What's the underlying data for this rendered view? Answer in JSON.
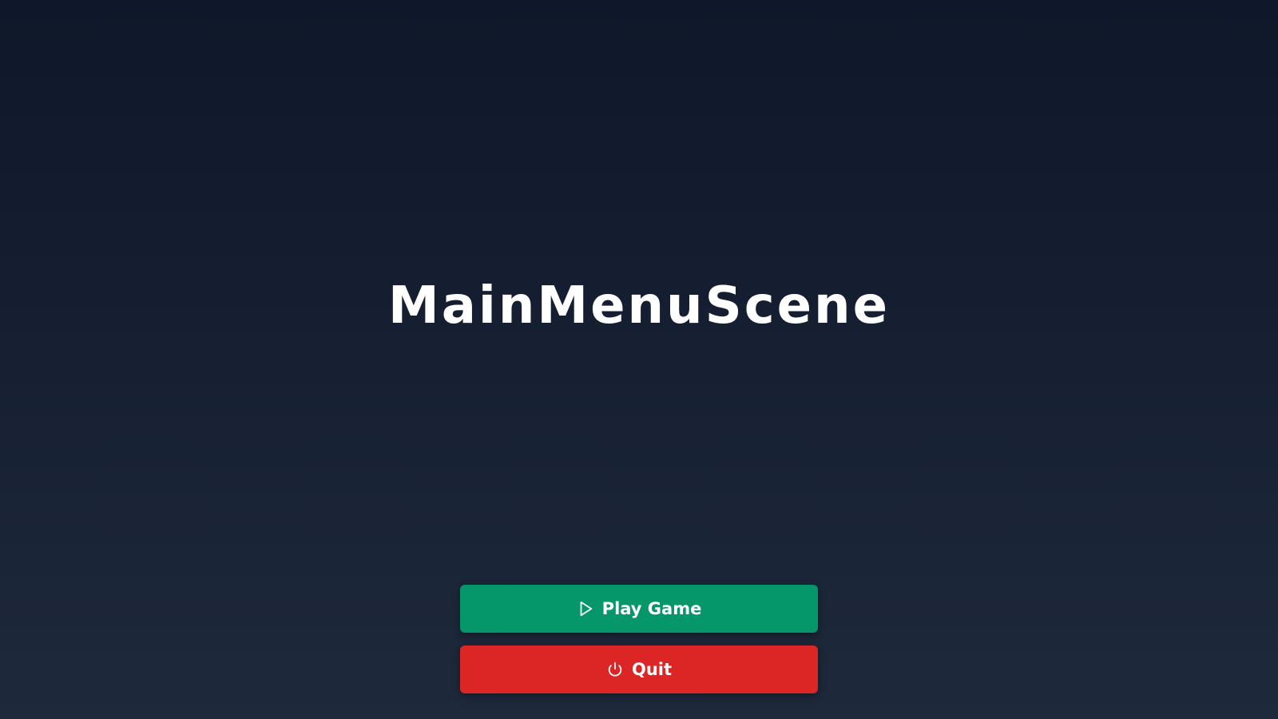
{
  "scene": {
    "title": "MainMenuScene",
    "background_top": "#0f172a",
    "background_bottom": "#1e293b"
  },
  "menu": {
    "buttons": [
      {
        "label": "Play Game",
        "icon": "play-icon",
        "color": "#059669"
      },
      {
        "label": "Quit",
        "icon": "power-icon",
        "color": "#dc2626"
      }
    ]
  }
}
